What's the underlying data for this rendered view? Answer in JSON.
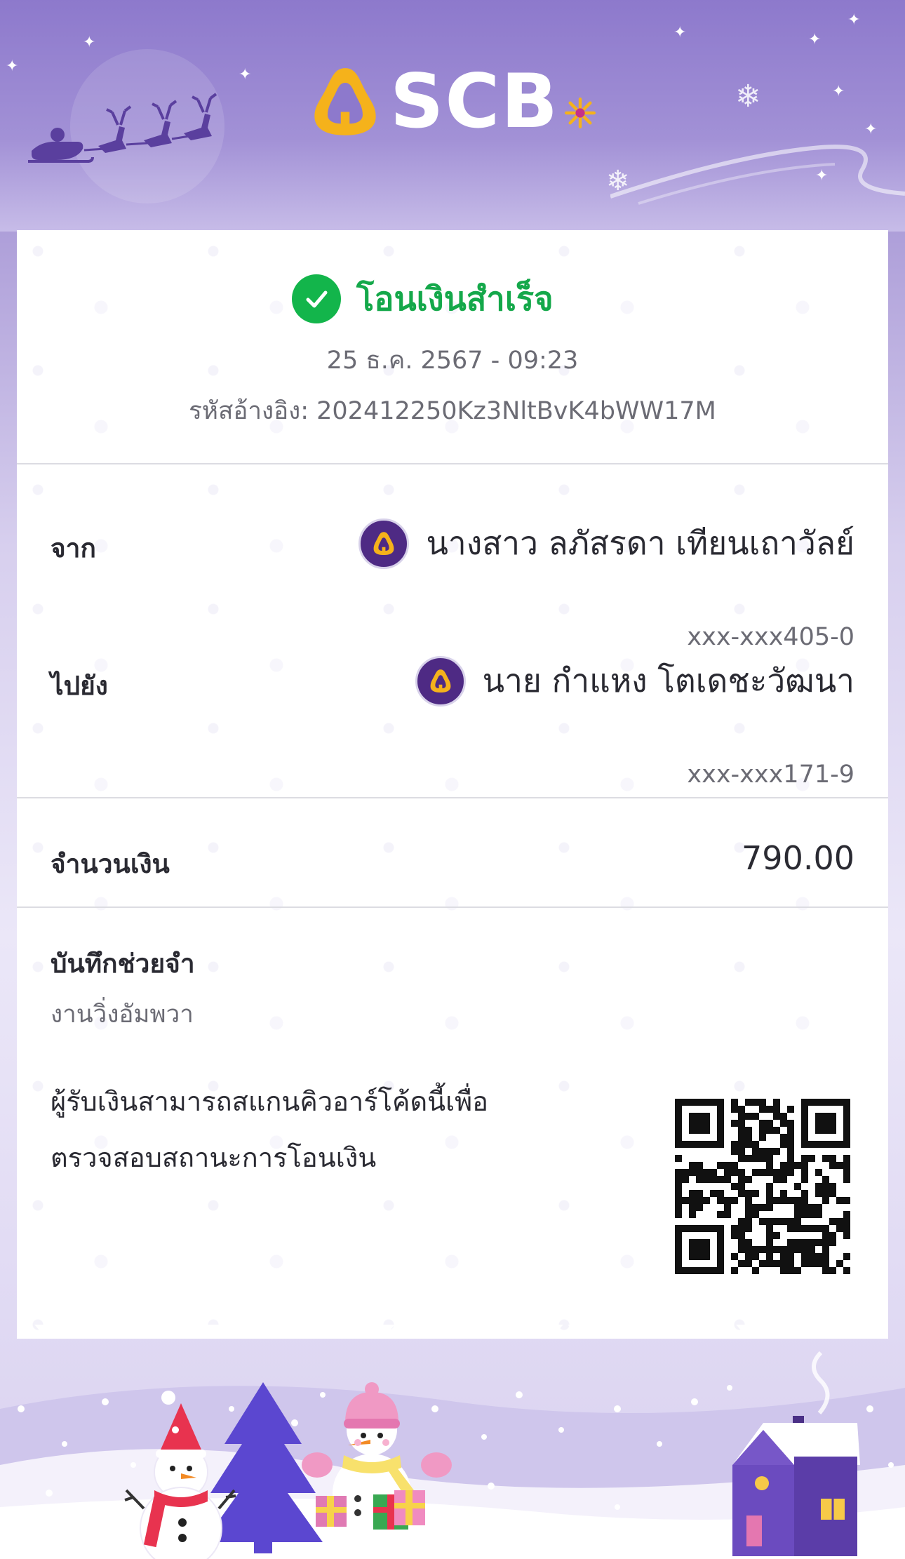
{
  "header": {
    "brand": "SCB",
    "logo_icon": "scb-building-icon"
  },
  "status": {
    "text": "โอนเงินสำเร็จ",
    "icon": "check-circle-icon",
    "color": "#13b54b"
  },
  "datetime": "25 ธ.ค. 2567 - 09:23",
  "reference": "รหัสอ้างอิง: 202412250Kz3NltBvK4bWW17M",
  "from": {
    "label": "จาก",
    "name": "นางสาว ลภัสรดา เทียนเถาวัลย์",
    "account": "xxx-xxx405-0",
    "bank_icon": "scb-bank-icon"
  },
  "to": {
    "label": "ไปยัง",
    "name": "นาย กำแหง โตเดชะวัฒนา",
    "account": "xxx-xxx171-9",
    "bank_icon": "scb-bank-icon"
  },
  "amount": {
    "label": "จำนวนเงิน",
    "value": "790.00"
  },
  "memo": {
    "label": "บันทึกช่วยจำ",
    "value": "งานวิ่งอัมพวา"
  },
  "qr": {
    "line1": "ผู้รับเงินสามารถสแกนคิวอาร์โค้ดนี้เพื่อ",
    "line2": "ตรวจสอบสถานะการโอนเงิน",
    "icon": "qr-code-icon"
  },
  "theme": {
    "brand_purple": "#4e2a84",
    "accent_gold": "#f5b21b",
    "success_green": "#13b54b"
  }
}
